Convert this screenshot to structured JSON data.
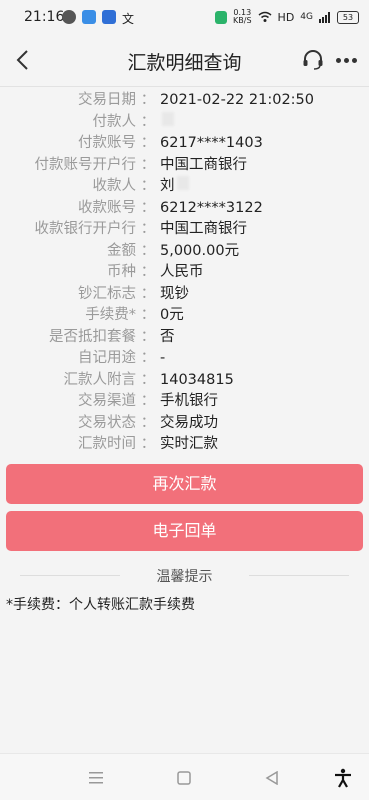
{
  "status_bar": {
    "time": "21:16",
    "net_speed": "0.13",
    "net_unit": "KB/S",
    "hd": "HD",
    "signal": "4G",
    "battery": "53"
  },
  "header": {
    "title": "汇款明细查询"
  },
  "details": [
    {
      "label": "交易日期",
      "value": "2021-02-22 21:02:50"
    },
    {
      "label": "付款人",
      "value": "",
      "masked": true
    },
    {
      "label": "付款账号",
      "value": "6217****1403"
    },
    {
      "label": "付款账号开户行",
      "value": "中国工商银行"
    },
    {
      "label": "收款人",
      "value": "刘",
      "masked": true
    },
    {
      "label": "收款账号",
      "value": "6212****3122"
    },
    {
      "label": "收款银行开户行",
      "value": "中国工商银行"
    },
    {
      "label": "金额",
      "value": "5,000.00元"
    },
    {
      "label": "币种",
      "value": "人民币"
    },
    {
      "label": "钞汇标志",
      "value": "现钞"
    },
    {
      "label": "手续费*",
      "value": "0元"
    },
    {
      "label": "是否抵扣套餐",
      "value": "否"
    },
    {
      "label": "自记用途",
      "value": "-"
    },
    {
      "label": "汇款人附言",
      "value": "14034815"
    },
    {
      "label": "交易渠道",
      "value": "手机银行"
    },
    {
      "label": "交易状态",
      "value": "交易成功"
    },
    {
      "label": "汇款时间",
      "value": "实时汇款"
    }
  ],
  "colon": "：",
  "actions": {
    "remit_again": "再次汇款",
    "e_receipt": "电子回单"
  },
  "tips": {
    "title": "温馨提示",
    "text": "*手续费：个人转账汇款手续费"
  },
  "colors": {
    "accent": "#f2707a"
  }
}
